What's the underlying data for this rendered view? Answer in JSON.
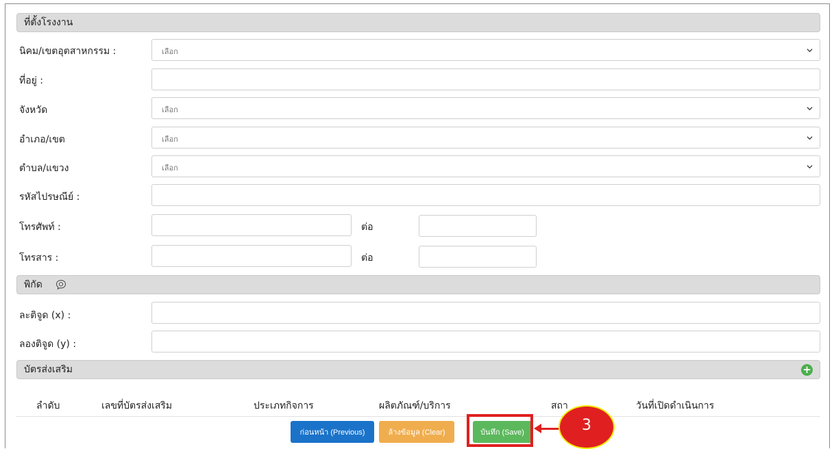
{
  "location": {
    "header": "ที่ตั้งโรงงาน",
    "estate_label": "นิคม/เขตอุตสาหกรรม :",
    "estate_value": "เลือก",
    "address_label": "ที่อยู่ :",
    "address_value": "",
    "province_label": "จังหวัด",
    "province_value": "เลือก",
    "district_label": "อำเภอ/เขต",
    "district_value": "เลือก",
    "subdistrict_label": "ตำบล/แขวง",
    "subdistrict_value": "เลือก",
    "postal_label": "รหัสไปรษณีย์ :",
    "postal_value": "",
    "phone_label": "โทรศัพท์ :",
    "phone_value": "",
    "phone_ext_label": "ต่อ",
    "phone_ext_value": "",
    "fax_label": "โทรสาร :",
    "fax_value": "",
    "fax_ext_label": "ต่อ",
    "fax_ext_value": ""
  },
  "coordinates": {
    "header": "พิกัด",
    "latitude_label": "ละติจูด (x) :",
    "latitude_value": "",
    "longitude_label": "ลองติจูด (y) :",
    "longitude_value": ""
  },
  "promotion": {
    "header": "บัตรส่งเสริม",
    "columns": [
      "ลำดับ",
      "เลขที่บัตรส่งเสริม",
      "ประเภทกิจการ",
      "ผลิตภัณฑ์/บริการ",
      "สถา",
      "วันที่เปิดดำเนินการ"
    ]
  },
  "buttons": {
    "previous": "ก่อนหน้า (Previous)",
    "clear": "ล้างข้อมูล (Clear)",
    "save": "บันทึก (Save)"
  },
  "annotation": {
    "step_number": "3"
  },
  "colors": {
    "primary": "#1a73c9",
    "warning": "#f0ad4e",
    "success": "#5cb85c",
    "annotation_red": "#e02020",
    "annotation_yellow": "#f2e900"
  }
}
